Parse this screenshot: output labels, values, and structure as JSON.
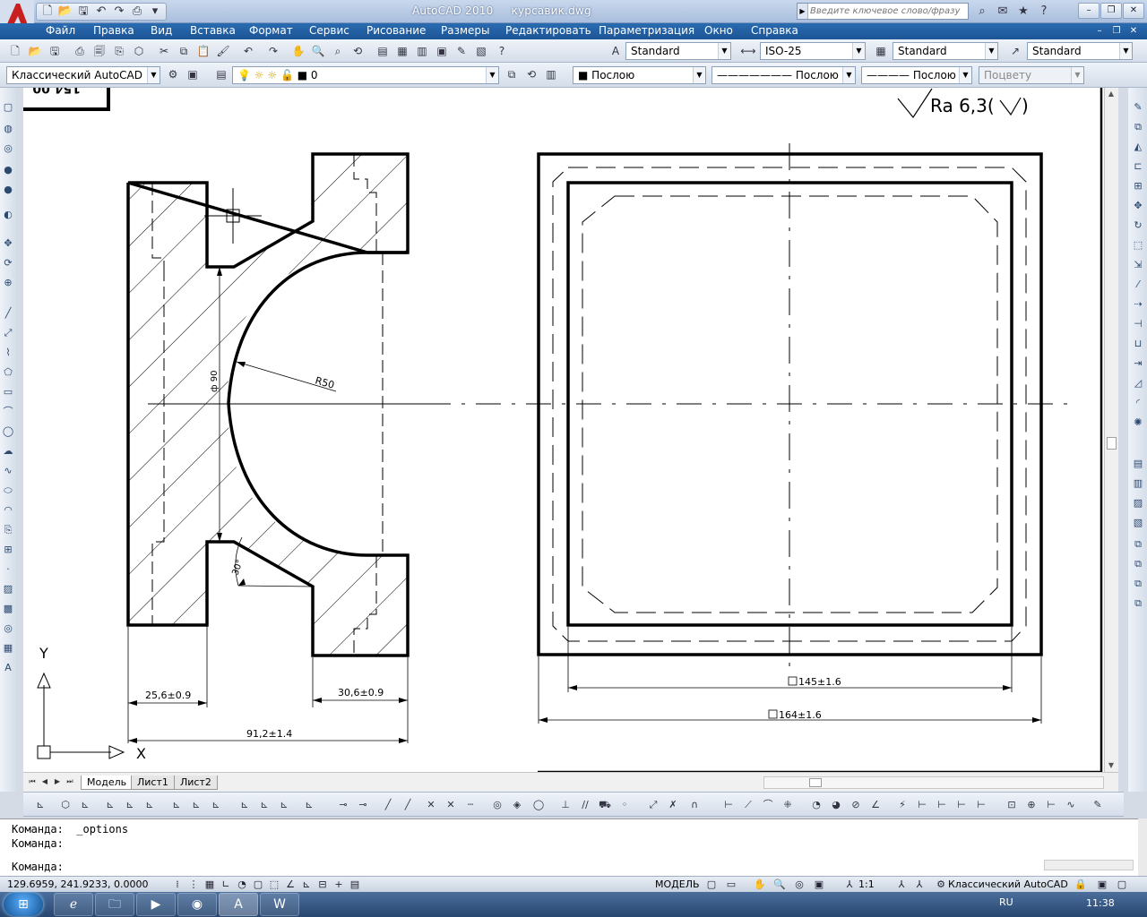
{
  "window": {
    "app_name": "AutoCAD 2010",
    "file_name": "курсавик.dwg",
    "search_placeholder": "Введите ключевое слово/фразу"
  },
  "menu": [
    "Файл",
    "Правка",
    "Вид",
    "Вставка",
    "Формат",
    "Сервис",
    "Рисование",
    "Размеры",
    "Редактировать",
    "Параметризация",
    "Окно",
    "Справка"
  ],
  "styles_toolbar": {
    "text_style": "Standard",
    "dim_style": "ISO-25",
    "table_style": "Standard",
    "multileader_style": "Standard"
  },
  "properties_toolbar": {
    "workspace": "Классический AutoCAD",
    "layer": "0",
    "color": "Послою",
    "linetype": "Послою",
    "lineweight": "Послою",
    "plot_style": "Поцвету"
  },
  "drawing": {
    "roughness": "Ra 6,3(",
    "roughness_close": ")",
    "dim_radius": "R50",
    "dim_diameter": "ф 90",
    "dim_angle": "30°",
    "dim_left_flange": "25,6±0.9",
    "dim_right_flange": "30,6±0.9",
    "dim_overall": "91,2±1.4",
    "dim_inner_square": "145±1.6",
    "dim_outer_square": "164±1.6",
    "title_block_fragment": "154 00",
    "ucs_y": "Y",
    "ucs_x": "X"
  },
  "tabs": {
    "model": "Модель",
    "layout1": "Лист1",
    "layout2": "Лист2"
  },
  "command_line": {
    "line1": "Команда:  _options",
    "line2": "Команда:",
    "prompt": "Команда:",
    "input_value": ""
  },
  "statusbar": {
    "coords": "129.6959, 241.9233, 0.0000",
    "model": "МОДЕЛЬ",
    "scale": "1:1",
    "workspace": "Классический AutoCAD"
  },
  "taskbar": {
    "language": "RU",
    "time": "11:38"
  },
  "colors": {
    "menu_bar": "#1f5b9c",
    "canvas": "#ffffff",
    "accent_red": "#c8201e"
  }
}
